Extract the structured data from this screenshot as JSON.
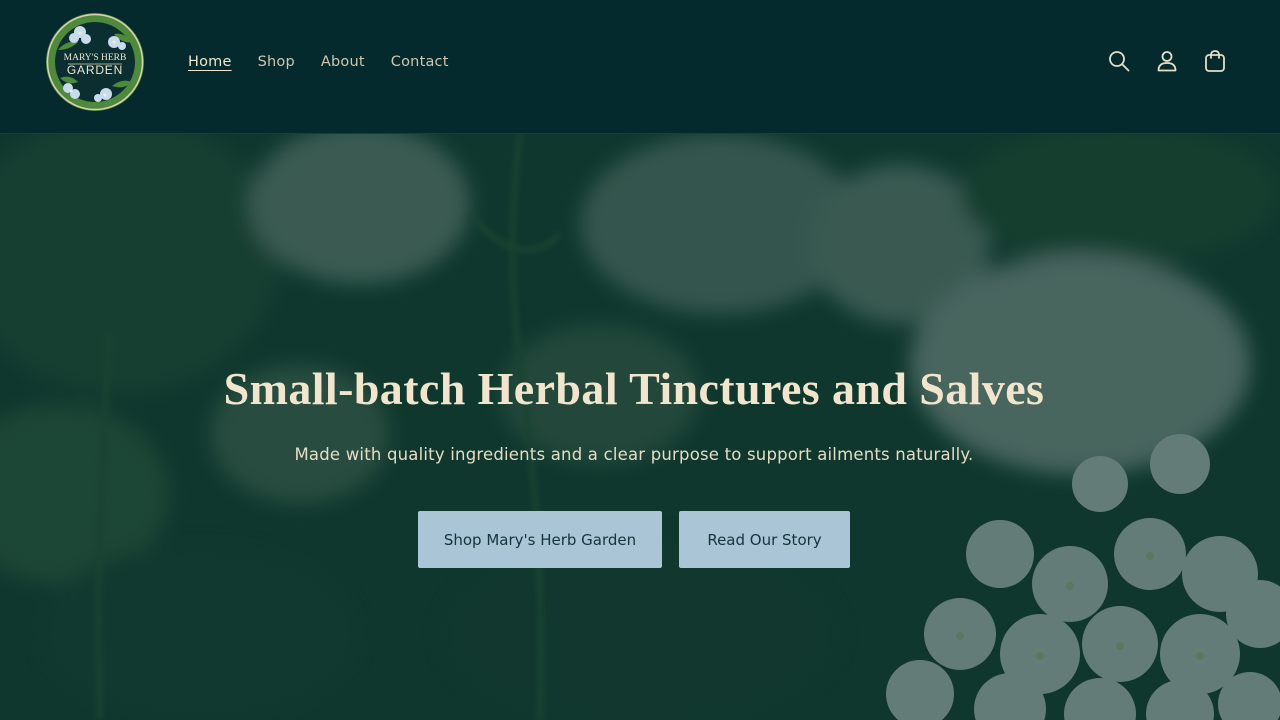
{
  "brand": {
    "logo_line1": "MARY'S HERB",
    "logo_line2": "GARDEN"
  },
  "nav": {
    "items": [
      {
        "label": "Home",
        "active": true
      },
      {
        "label": "Shop"
      },
      {
        "label": "About"
      },
      {
        "label": "Contact"
      }
    ]
  },
  "header_icons": [
    "search-icon",
    "account-icon",
    "cart-icon"
  ],
  "hero": {
    "title": "Small-batch Herbal Tinctures and Salves",
    "subtitle": "Made with quality ingredients and a clear purpose to support ailments naturally.",
    "primary_button": "Shop Mary's Herb Garden",
    "secondary_button": "Read Our Story"
  },
  "colors": {
    "header_bg": "#052a2d",
    "title_text": "#f1e6cd",
    "button_bg": "#a9c5d6",
    "logo_green": "#4f8a3c"
  }
}
